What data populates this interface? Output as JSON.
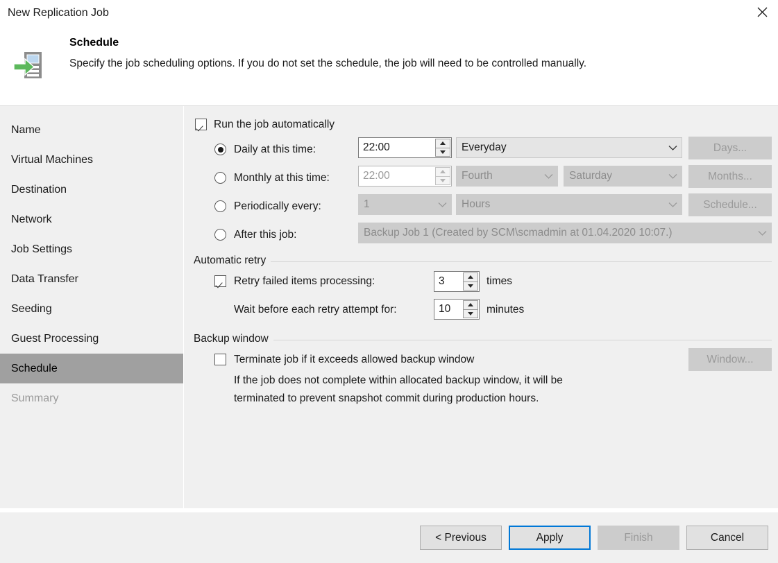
{
  "window": {
    "title": "New Replication Job",
    "close_label": "×"
  },
  "header": {
    "icon": "replication-job-icon",
    "title": "Schedule",
    "description": "Specify the job scheduling options. If you do not set the schedule, the job will need to be controlled manually."
  },
  "sidebar": {
    "items": [
      {
        "label": "Name",
        "state": "normal"
      },
      {
        "label": "Virtual Machines",
        "state": "normal"
      },
      {
        "label": "Destination",
        "state": "normal"
      },
      {
        "label": "Network",
        "state": "normal"
      },
      {
        "label": "Job Settings",
        "state": "normal"
      },
      {
        "label": "Data Transfer",
        "state": "normal"
      },
      {
        "label": "Seeding",
        "state": "normal"
      },
      {
        "label": "Guest Processing",
        "state": "normal"
      },
      {
        "label": "Schedule",
        "state": "selected"
      },
      {
        "label": "Summary",
        "state": "disabled"
      }
    ]
  },
  "schedule": {
    "run_automatically": {
      "label": "Run the job automatically",
      "checked": true
    },
    "daily": {
      "label": "Daily at this time:",
      "selected": true,
      "time": "22:00",
      "day_option": "Everyday",
      "button": "Days..."
    },
    "monthly": {
      "label": "Monthly at this time:",
      "selected": false,
      "time": "22:00",
      "week_option": "Fourth",
      "day_option": "Saturday",
      "button": "Months..."
    },
    "periodically": {
      "label": "Periodically every:",
      "selected": false,
      "count": "1",
      "unit": "Hours",
      "button": "Schedule..."
    },
    "after_job": {
      "label": "After this job:",
      "selected": false,
      "value": "Backup Job 1 (Created by SCM\\scmadmin at 01.04.2020 10:07.)"
    }
  },
  "automatic_retry": {
    "group_label": "Automatic retry",
    "retry": {
      "label": "Retry failed items processing:",
      "checked": true,
      "value": "3",
      "unit": "times"
    },
    "wait": {
      "label": "Wait before each retry attempt for:",
      "value": "10",
      "unit": "minutes"
    }
  },
  "backup_window": {
    "group_label": "Backup window",
    "terminate": {
      "label": "Terminate job if it exceeds allowed backup window",
      "checked": false
    },
    "button": "Window...",
    "hint_line1": "If the job does not complete within allocated backup window, it will be",
    "hint_line2": "terminated to prevent snapshot commit during production hours."
  },
  "footer": {
    "previous": "< Previous",
    "apply": "Apply",
    "finish": "Finish",
    "cancel": "Cancel"
  },
  "colors": {
    "accent": "#0078d7",
    "icon_green": "#5cb85c",
    "icon_gray": "#8c8c8c",
    "surface": "#f0f0f0",
    "selected_row": "#a0a0a0"
  }
}
